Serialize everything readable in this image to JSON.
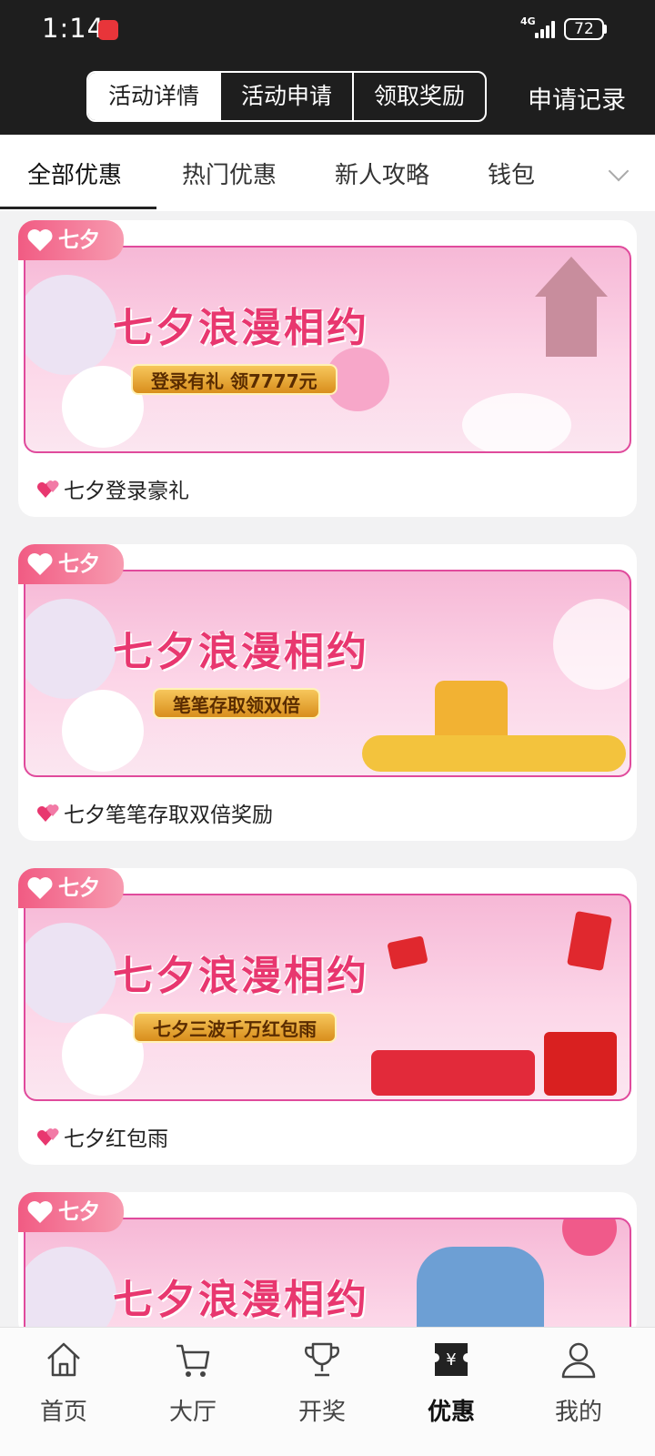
{
  "status": {
    "time": "1:14",
    "network": "4G",
    "battery": "72"
  },
  "top_tabs": {
    "details": "活动详情",
    "apply": "活动申请",
    "claim": "领取奖励"
  },
  "record_link": "申请记录",
  "categories": [
    "全部优惠",
    "热门优惠",
    "新人攻略",
    "钱包"
  ],
  "card_tag": "七夕",
  "cards": [
    {
      "banner_title": "七夕浪漫相约",
      "banner_pill": "登录有礼 领7777元",
      "caption": "七夕登录豪礼"
    },
    {
      "banner_title": "七夕浪漫相约",
      "banner_pill": "笔笔存取领双倍",
      "caption": "七夕笔笔存取双倍奖励"
    },
    {
      "banner_title": "七夕浪漫相约",
      "banner_pill": "七夕三波千万红包雨",
      "caption": "七夕红包雨"
    },
    {
      "banner_title": "七夕浪漫相约"
    }
  ],
  "bottom_nav": [
    {
      "label": "首页",
      "icon": "home-icon"
    },
    {
      "label": "大厅",
      "icon": "cart-icon"
    },
    {
      "label": "开奖",
      "icon": "trophy-icon"
    },
    {
      "label": "优惠",
      "icon": "coupon-icon",
      "active": true
    },
    {
      "label": "我的",
      "icon": "user-icon"
    }
  ],
  "colors": {
    "accent_pink": "#e8376f",
    "banner_border": "#e04a9c",
    "dark_header": "#1e1e1e"
  }
}
